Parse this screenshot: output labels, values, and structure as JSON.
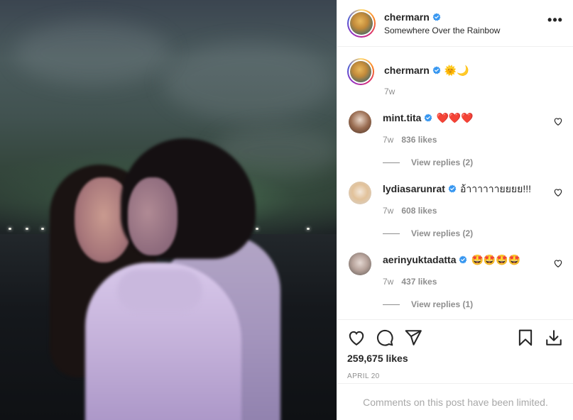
{
  "header": {
    "username": "chermarn",
    "location": "Somewhere Over the Rainbow",
    "more_label": "•••"
  },
  "caption": {
    "username": "chermarn",
    "text": "🌞🌙",
    "time": "7w"
  },
  "comments": [
    {
      "username": "mint.tita",
      "verified": true,
      "text": "❤️❤️❤️",
      "time": "7w",
      "likes": "836 likes",
      "replies": "View replies (2)"
    },
    {
      "username": "lydiasarunrat",
      "verified": true,
      "text": "อ้าาาาาายยยย!!!",
      "time": "7w",
      "likes": "608 likes",
      "replies": "View replies (2)"
    },
    {
      "username": "aerinyuktadatta",
      "verified": true,
      "text": "🤩🤩🤩🤩",
      "time": "7w",
      "likes": "437 likes",
      "replies": "View replies (1)"
    }
  ],
  "actions": {
    "like_count": "259,675 likes",
    "date": "APRIL 20"
  },
  "footer": {
    "limited_text": "Comments on this post have been limited."
  },
  "colors": {
    "verified_blue": "#3897f0",
    "text_primary": "#262626",
    "text_secondary": "#8e8e8e",
    "border": "#efefef"
  },
  "icons": [
    "more-icon",
    "verified-icon",
    "heart-icon",
    "comment-icon",
    "share-icon",
    "save-icon",
    "download-icon"
  ]
}
